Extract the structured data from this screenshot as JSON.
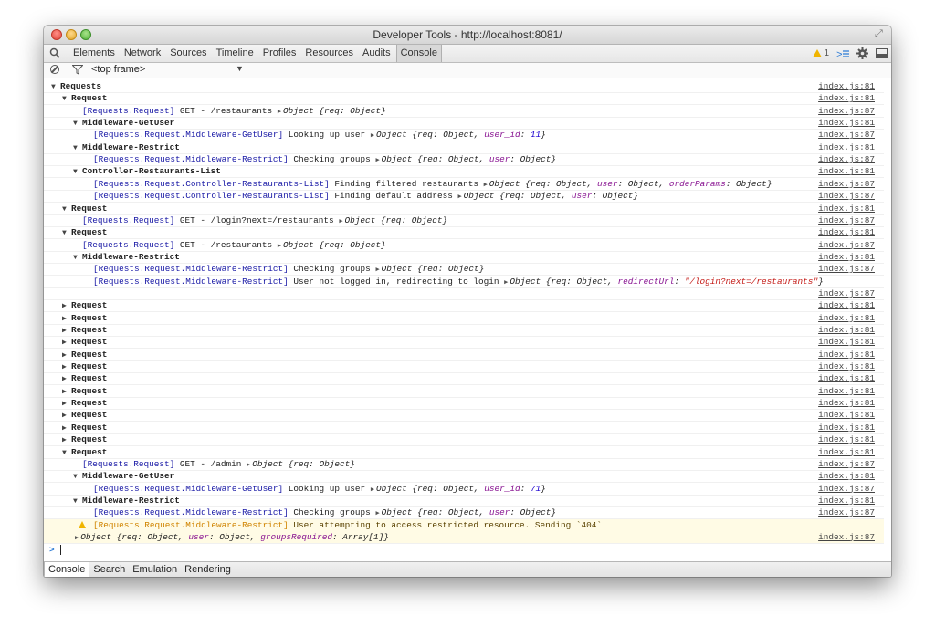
{
  "window": {
    "title": "Developer Tools - http://localhost:8081/"
  },
  "toolbar": {
    "tabs": [
      "Elements",
      "Network",
      "Sources",
      "Timeline",
      "Profiles",
      "Resources",
      "Audits",
      "Console"
    ],
    "active_tab": "Console",
    "warning_count": "1",
    "warning_color": "#f0b400"
  },
  "filter": {
    "frame": "<top frame>"
  },
  "console": {
    "source_81": "index.js:81",
    "source_87": "index.js:87",
    "lines": [
      {
        "kind": "group",
        "depth": 0,
        "open": true,
        "label": "Requests",
        "src": "index.js:81"
      },
      {
        "kind": "group",
        "depth": 1,
        "open": true,
        "label": "Request",
        "src": "index.js:81"
      },
      {
        "kind": "log",
        "depth": 2,
        "tag": "[Requests.Request]",
        "msg": "GET - /restaurants",
        "obj": "Object {req: Object}",
        "src": "index.js:87"
      },
      {
        "kind": "group",
        "depth": 2,
        "open": true,
        "label": "Middleware-GetUser",
        "src": "index.js:81"
      },
      {
        "kind": "log",
        "depth": 3,
        "tag": "[Requests.Request.Middleware-GetUser]",
        "msg": "Looking up user",
        "obj": "Object {req: Object, user_id: 11}",
        "src": "index.js:87"
      },
      {
        "kind": "group",
        "depth": 2,
        "open": true,
        "label": "Middleware-Restrict",
        "src": "index.js:81"
      },
      {
        "kind": "log",
        "depth": 3,
        "tag": "[Requests.Request.Middleware-Restrict]",
        "msg": "Checking groups",
        "obj": "Object {req: Object, user: Object}",
        "src": "index.js:87"
      },
      {
        "kind": "group",
        "depth": 2,
        "open": true,
        "label": "Controller-Restaurants-List",
        "src": "index.js:81"
      },
      {
        "kind": "log",
        "depth": 3,
        "tag": "[Requests.Request.Controller-Restaurants-List]",
        "msg": "Finding filtered restaurants",
        "obj": "Object {req: Object, user: Object, orderParams: Object}",
        "src": "index.js:87"
      },
      {
        "kind": "log",
        "depth": 3,
        "tag": "[Requests.Request.Controller-Restaurants-List]",
        "msg": "Finding default address",
        "obj": "Object {req: Object, user: Object}",
        "src": "index.js:87"
      },
      {
        "kind": "group",
        "depth": 1,
        "open": true,
        "label": "Request",
        "src": "index.js:81"
      },
      {
        "kind": "log",
        "depth": 2,
        "tag": "[Requests.Request]",
        "msg": "GET - /login?next=/restaurants",
        "obj": "Object {req: Object}",
        "src": "index.js:87"
      },
      {
        "kind": "group",
        "depth": 1,
        "open": true,
        "label": "Request",
        "src": "index.js:81"
      },
      {
        "kind": "log",
        "depth": 2,
        "tag": "[Requests.Request]",
        "msg": "GET - /restaurants",
        "obj": "Object {req: Object}",
        "src": "index.js:87"
      },
      {
        "kind": "group",
        "depth": 2,
        "open": true,
        "label": "Middleware-Restrict",
        "src": "index.js:81"
      },
      {
        "kind": "log",
        "depth": 3,
        "tag": "[Requests.Request.Middleware-Restrict]",
        "msg": "Checking groups",
        "obj": "Object {req: Object}",
        "src": "index.js:87"
      },
      {
        "kind": "log",
        "depth": 3,
        "tag": "[Requests.Request.Middleware-Restrict]",
        "msg": "User not logged in, redirecting to login",
        "obj": "Object {req: Object, redirectUrl: \"/login?next=/restaurants\"}",
        "src": ""
      },
      {
        "kind": "src-only",
        "depth": 0,
        "src": "index.js:87"
      },
      {
        "kind": "group",
        "depth": 1,
        "open": false,
        "label": "Request",
        "src": "index.js:81"
      },
      {
        "kind": "group",
        "depth": 1,
        "open": false,
        "label": "Request",
        "src": "index.js:81"
      },
      {
        "kind": "group",
        "depth": 1,
        "open": false,
        "label": "Request",
        "src": "index.js:81"
      },
      {
        "kind": "group",
        "depth": 1,
        "open": false,
        "label": "Request",
        "src": "index.js:81"
      },
      {
        "kind": "group",
        "depth": 1,
        "open": false,
        "label": "Request",
        "src": "index.js:81"
      },
      {
        "kind": "group",
        "depth": 1,
        "open": false,
        "label": "Request",
        "src": "index.js:81"
      },
      {
        "kind": "group",
        "depth": 1,
        "open": false,
        "label": "Request",
        "src": "index.js:81"
      },
      {
        "kind": "group",
        "depth": 1,
        "open": false,
        "label": "Request",
        "src": "index.js:81"
      },
      {
        "kind": "group",
        "depth": 1,
        "open": false,
        "label": "Request",
        "src": "index.js:81"
      },
      {
        "kind": "group",
        "depth": 1,
        "open": false,
        "label": "Request",
        "src": "index.js:81"
      },
      {
        "kind": "group",
        "depth": 1,
        "open": false,
        "label": "Request",
        "src": "index.js:81"
      },
      {
        "kind": "group",
        "depth": 1,
        "open": false,
        "label": "Request",
        "src": "index.js:81"
      },
      {
        "kind": "group",
        "depth": 1,
        "open": true,
        "label": "Request",
        "src": "index.js:81"
      },
      {
        "kind": "log",
        "depth": 2,
        "tag": "[Requests.Request]",
        "msg": "GET - /admin",
        "obj": "Object {req: Object}",
        "src": "index.js:87"
      },
      {
        "kind": "group",
        "depth": 2,
        "open": true,
        "label": "Middleware-GetUser",
        "src": "index.js:81"
      },
      {
        "kind": "log",
        "depth": 3,
        "tag": "[Requests.Request.Middleware-GetUser]",
        "msg": "Looking up user",
        "obj": "Object {req: Object, user_id: 71}",
        "src": "index.js:87"
      },
      {
        "kind": "group",
        "depth": 2,
        "open": true,
        "label": "Middleware-Restrict",
        "src": "index.js:81"
      },
      {
        "kind": "log",
        "depth": 3,
        "tag": "[Requests.Request.Middleware-Restrict]",
        "msg": "Checking groups",
        "obj": "Object {req: Object, user: Object}",
        "src": "index.js:87"
      },
      {
        "kind": "warn",
        "depth": 3,
        "tag": "[Requests.Request.Middleware-Restrict]",
        "msg": "User attempting to access restricted resource. Sending `404`",
        "obj": "Object {req: Object, user: Object, groupsRequired: Array[1]}",
        "src": "index.js:87"
      }
    ]
  },
  "prompt": ">",
  "drawer": {
    "tabs": [
      "Console",
      "Search",
      "Emulation",
      "Rendering"
    ],
    "active": "Console"
  }
}
